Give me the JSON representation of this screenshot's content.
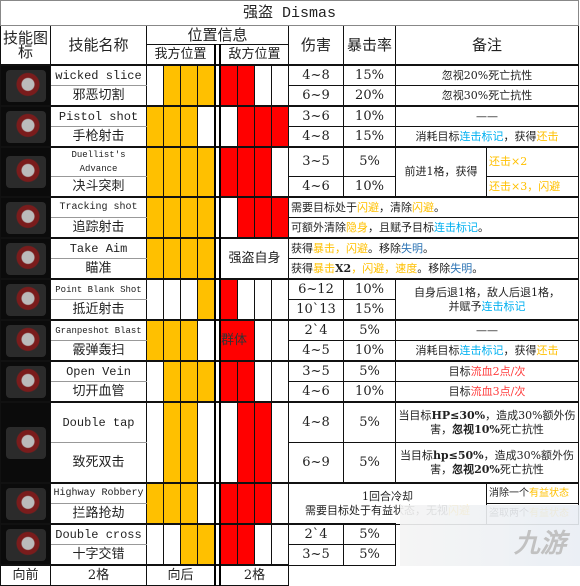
{
  "title": "强盗 Dismas",
  "colors": {
    "my_position": "#ffc000",
    "enemy_position": "#ff0000",
    "yellow": "#ffc000",
    "blue": "#00b0f0",
    "darkblue": "#2f75b5",
    "red": "#ff3b3b"
  },
  "header": {
    "icon": "技能图标",
    "name": "技能名称",
    "position": "位置信息",
    "my_pos": "我方位置",
    "enemy_pos": "敌方位置",
    "damage": "伤害",
    "crit": "暴击率",
    "notes": "备注"
  },
  "skills": [
    {
      "icon": "wicked-slice-icon",
      "en": "wicked slice",
      "zh": "邪恶切割",
      "my": [
        0,
        1,
        1,
        1
      ],
      "enemy": [
        1,
        1,
        0,
        0
      ],
      "rows": [
        {
          "dmg": "4~8",
          "crit": "15%"
        },
        {
          "dmg": "6~9",
          "crit": "20%"
        }
      ],
      "layout": "each",
      "notes": [
        [
          {
            "t": "忽视20%死亡抗性"
          }
        ],
        [
          {
            "t": "忽视30%死亡抗性"
          }
        ]
      ]
    },
    {
      "icon": "pistol-shot-icon",
      "en": "Pistol shot",
      "zh": "手枪射击",
      "my": [
        1,
        1,
        1,
        0
      ],
      "enemy": [
        0,
        1,
        1,
        1
      ],
      "rows": [
        {
          "dmg": "3~6",
          "crit": "10%"
        },
        {
          "dmg": "4~8",
          "crit": "15%"
        }
      ],
      "layout": "each",
      "notes": [
        [
          {
            "t": "——"
          }
        ],
        [
          {
            "t": "消耗目标"
          },
          {
            "t": "连击标记",
            "c": "blue"
          },
          {
            "t": "，获得"
          },
          {
            "t": "还击",
            "c": "yellow"
          }
        ]
      ]
    },
    {
      "icon": "duellists-advance-icon",
      "en": "Duellist's Advance",
      "zh": "决斗突刺",
      "my": [
        1,
        1,
        1,
        1
      ],
      "enemy": [
        1,
        1,
        1,
        0
      ],
      "rows": [
        {
          "dmg": "3~5",
          "crit": "5%"
        },
        {
          "dmg": "4~6",
          "crit": "10%"
        }
      ],
      "layout": "split",
      "left": [
        [
          {
            "t": "前进1格，获得"
          }
        ]
      ],
      "right": [
        [
          {
            "t": "还击×2",
            "c": "yellow"
          }
        ],
        [
          {
            "t": "还击×3，闪避",
            "c": "yellow"
          }
        ]
      ]
    },
    {
      "icon": "tracking-shot-icon",
      "en": "Tracking shot",
      "zh": "追踪射击",
      "my": [
        1,
        1,
        1,
        1
      ],
      "enemy": [
        0,
        1,
        1,
        1
      ],
      "layout": "wide",
      "notes": [
        [
          {
            "t": "需要目标处于"
          },
          {
            "t": "闪避",
            "c": "yellow"
          },
          {
            "t": "，清除"
          },
          {
            "t": "闪避",
            "c": "yellow"
          },
          {
            "t": "。"
          }
        ],
        [
          {
            "t": "可额外清除"
          },
          {
            "t": "隐身",
            "c": "yellow"
          },
          {
            "t": "，且赋予目标"
          },
          {
            "t": "连击标记",
            "c": "blue"
          },
          {
            "t": "。"
          }
        ]
      ]
    },
    {
      "icon": "take-aim-icon",
      "en": "Take Aim",
      "zh": "瞄准",
      "my": [
        1,
        1,
        1,
        1
      ],
      "enemy_label": "强盗自身",
      "layout": "wide",
      "notes": [
        [
          {
            "t": "获得"
          },
          {
            "t": "暴击，闪避",
            "c": "yellow"
          },
          {
            "t": "。移除"
          },
          {
            "t": "失明",
            "c": "darkblue"
          },
          {
            "t": "。"
          }
        ],
        [
          {
            "t": "获得"
          },
          {
            "t": "暴击",
            "c": "yellow"
          },
          {
            "t": "X2",
            "b": true
          },
          {
            "t": "，闪避，速度",
            "c": "yellow"
          },
          {
            "t": "。移除"
          },
          {
            "t": "失明",
            "c": "darkblue"
          },
          {
            "t": "。"
          }
        ]
      ]
    },
    {
      "icon": "point-blank-shot-icon",
      "en": "Point Blank Shot",
      "zh": "抵近射击",
      "my": [
        0,
        0,
        0,
        1
      ],
      "enemy": [
        1,
        0,
        0,
        0
      ],
      "rows": [
        {
          "dmg": "6~12",
          "crit": "10%"
        },
        {
          "dmg": "10`13",
          "crit": "15%"
        }
      ],
      "layout": "merged",
      "left": [
        [
          {
            "t": "自身后退1格，敌人后退1格，"
          }
        ],
        [
          {
            "t": "并赋予"
          },
          {
            "t": "连击标记",
            "c": "blue"
          }
        ]
      ]
    },
    {
      "icon": "grapeshot-blast-icon",
      "en": "Granpeshot Blast",
      "zh": "霰弹轰扫",
      "my": [
        1,
        1,
        1,
        0
      ],
      "enemy": [
        1,
        1,
        0,
        0
      ],
      "enemy_tag": "群体",
      "rows": [
        {
          "dmg": "2`4",
          "crit": "5%"
        },
        {
          "dmg": "4~5",
          "crit": "10%"
        }
      ],
      "layout": "each",
      "notes": [
        [
          {
            "t": "——"
          }
        ],
        [
          {
            "t": "消耗目标"
          },
          {
            "t": "连击标记",
            "c": "blue"
          },
          {
            "t": "，获得"
          },
          {
            "t": "还击",
            "c": "yellow"
          }
        ]
      ]
    },
    {
      "icon": "open-vein-icon",
      "en": "Open Vein",
      "zh": "切开血管",
      "my": [
        0,
        1,
        1,
        1
      ],
      "enemy": [
        1,
        1,
        0,
        0
      ],
      "rows": [
        {
          "dmg": "3~5",
          "crit": "5%"
        },
        {
          "dmg": "4~6",
          "crit": "10%"
        }
      ],
      "layout": "each",
      "notes": [
        [
          {
            "t": "目标"
          },
          {
            "t": "流血2点/次",
            "c": "red"
          }
        ],
        [
          {
            "t": "目标"
          },
          {
            "t": "流血3点/次",
            "c": "red"
          }
        ]
      ]
    },
    {
      "icon": "double-tap-icon",
      "en": "Double tap",
      "zh": "致死双击",
      "my": [
        0,
        1,
        1,
        0
      ],
      "enemy": [
        0,
        1,
        1,
        0
      ],
      "tall": true,
      "rows": [
        {
          "dmg": "4~8",
          "crit": "5%"
        },
        {
          "dmg": "6~9",
          "crit": "5%"
        }
      ],
      "layout": "each",
      "notes": [
        [
          {
            "t": "当目标"
          },
          {
            "t": "HP≤30%",
            "b": true
          },
          {
            "t": "，造成30%额外伤害，"
          },
          {
            "t": "忽视10%",
            "b": true
          },
          {
            "t": "死亡抗性"
          }
        ],
        [
          {
            "t": "当目标"
          },
          {
            "t": "hp≤50%",
            "b": true
          },
          {
            "t": "，造成30%额外伤害，"
          },
          {
            "t": "忽视20%",
            "b": true
          },
          {
            "t": "死亡抗性"
          }
        ]
      ]
    },
    {
      "icon": "highway-robbery-icon",
      "en": "Highway Robbery",
      "zh": "拦路抢劫",
      "my": [
        1,
        1,
        1,
        0
      ],
      "enemy": [
        1,
        1,
        1,
        0
      ],
      "layout": "widesplit",
      "left": [
        [
          {
            "t": "1回合冷却"
          }
        ],
        [
          {
            "t": "需要目标处于有益状态，无视"
          },
          {
            "t": "闪避",
            "c": "yellow"
          }
        ]
      ],
      "right": [
        [
          {
            "t": "消除一个"
          },
          {
            "t": "有益状态",
            "c": "yellow"
          }
        ],
        [
          {
            "t": "盗取两个"
          },
          {
            "t": "有益状态",
            "c": "yellow"
          }
        ]
      ]
    },
    {
      "icon": "double-cross-icon",
      "en": "Double cross",
      "zh": "十字交错",
      "my": [
        0,
        0,
        1,
        1
      ],
      "enemy": [
        1,
        1,
        0,
        0
      ],
      "rows": [
        {
          "dmg": "2`4",
          "crit": "5%"
        },
        {
          "dmg": "3~5",
          "crit": "5%"
        }
      ],
      "layout": "each",
      "notes": [
        [],
        []
      ]
    }
  ],
  "footer": {
    "forward": "向前",
    "forward_n": "2格",
    "back": "向后",
    "back_n": "2格"
  },
  "watermark": "九游"
}
